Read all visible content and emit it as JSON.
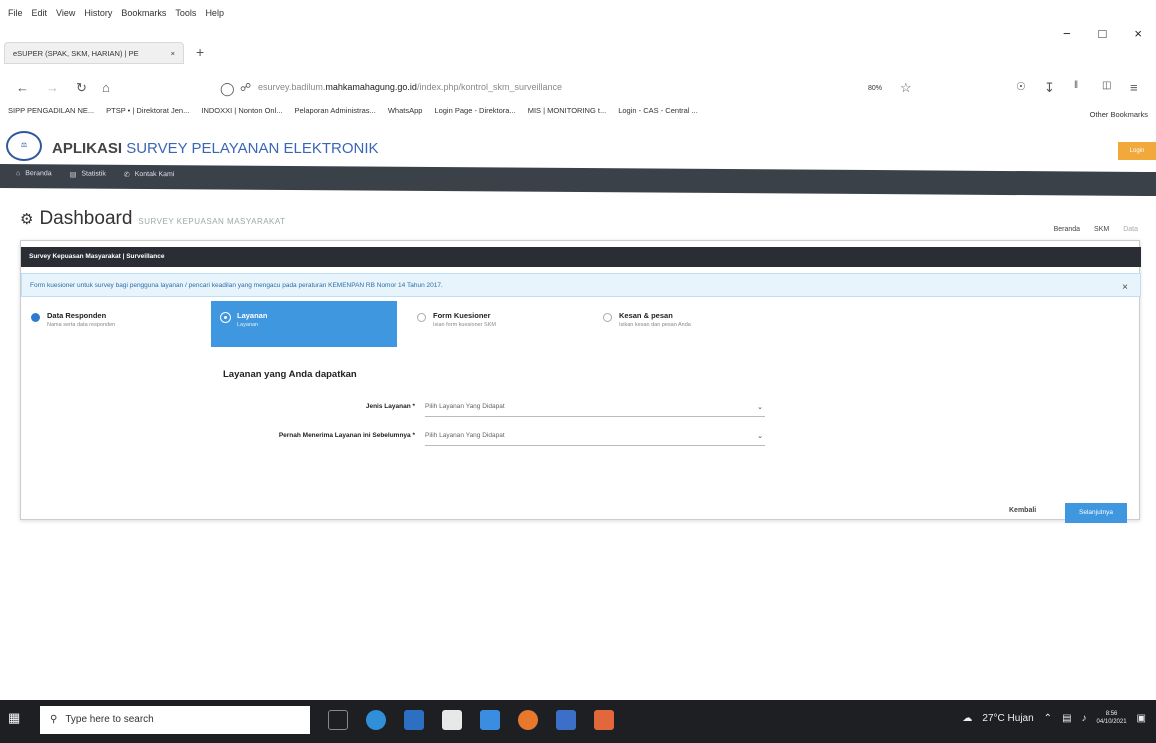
{
  "menubar": [
    "File",
    "Edit",
    "View",
    "History",
    "Bookmarks",
    "Tools",
    "Help"
  ],
  "window_controls": {
    "minimize": "−",
    "maximize": "□",
    "close": "×"
  },
  "tab": {
    "title": "eSUPER (SPAK, SKM, HARIAN) | PE",
    "close": "×",
    "new": "+"
  },
  "navbar": {
    "back": "←",
    "forward": "→",
    "reload": "↻",
    "home": "⌂",
    "url_prefix": "esurvey.badilum.",
    "url_domain": "mahkamahagung.go.id",
    "url_path": "/index.php/kontrol_skm_surveillance",
    "zoom": "80%"
  },
  "bookmarks": [
    "SIPP PENGADILAN NE...",
    "PTSP • | Direktorat Jen...",
    "INDOXXI | Nonton Onl...",
    "Pelaporan Administras...",
    "WhatsApp",
    "Login Page - Direktora...",
    "MIS | MONITORING t...",
    "Login - CAS - Central ..."
  ],
  "bookmarks_other": "Other Bookmarks",
  "app": {
    "title_main": "APLIKASI",
    "title_hl": "SURVEY PELAYANAN ELEKTRONIK",
    "login": "Login",
    "nav": [
      "Beranda",
      "Statistik",
      "Kontak Kami"
    ]
  },
  "dashboard": {
    "title": "Dashboard",
    "subtitle": "SURVEY KEPUASAN MASYARAKAT",
    "breadcrumbs": [
      "Beranda",
      "SKM",
      "Data"
    ]
  },
  "panel": {
    "heading": "Survey Kepuasan Masyarakat | Surveillance",
    "alert": "Form kuesioner untuk survey bagi pengguna layanan / pencari keadilan yang mengacu pada peraturan KEMENPAN RB Nomor 14 Tahun 2017.",
    "alert_close": "×",
    "steps": [
      {
        "title": "Data Responden",
        "desc": "Nama serta data responden"
      },
      {
        "title": "Layanan",
        "desc": "Layanan"
      },
      {
        "title": "Form Kuesioner",
        "desc": "Isian form kuesioner SKM"
      },
      {
        "title": "Kesan & pesan",
        "desc": "Isikan kesan dan pesan Anda"
      }
    ],
    "form_title": "Layanan yang Anda dapatkan",
    "fields": [
      {
        "label": "Jenis Layanan *",
        "value": "Pilih Layanan Yang Didapat"
      },
      {
        "label": "Pernah Menerima Layanan ini Sebelumnya *",
        "value": "Pilih Layanan Yang Didapat"
      }
    ],
    "back": "Kembali",
    "next": "Selanjutnya"
  },
  "taskbar": {
    "search_placeholder": "Type here to search",
    "weather": "27°C Hujan",
    "time": "8:56",
    "date": "04/10/2021"
  }
}
